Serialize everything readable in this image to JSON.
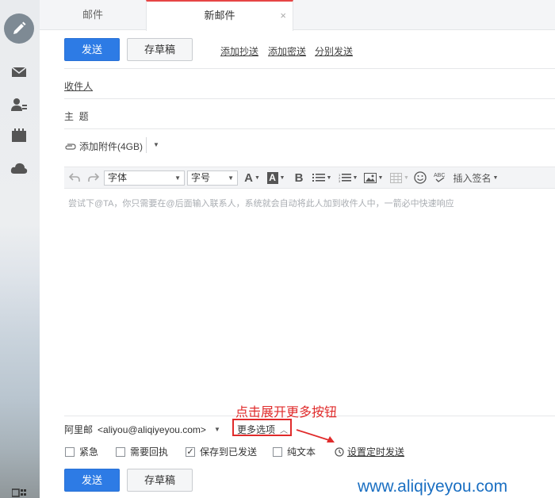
{
  "tabs": {
    "mail": "邮件",
    "new_mail": "新邮件",
    "close": "×"
  },
  "toolbar_top": {
    "send": "发送",
    "draft": "存草稿",
    "add_cc": "添加抄送",
    "add_bcc": "添加密送",
    "separate_send": "分别发送"
  },
  "fields": {
    "recipient": "收件人",
    "subject": "主  题",
    "attach": "添加附件(4GB)"
  },
  "editor": {
    "font": "字体",
    "size": "字号",
    "signature": "插入签名",
    "placeholder": "尝试下@TA，你只需要在@后面输入联系人，系统就会自动将此人加到收件人中，一箭必中快速响应"
  },
  "footer": {
    "sender_name": "阿里邮",
    "sender_email": "<aliyou@aliqiyeyou.com>",
    "more_options": "更多选项",
    "urgent": "紧急",
    "receipt": "需要回执",
    "save_sent": "保存到已发送",
    "plain_text": "纯文本",
    "schedule": "设置定时发送",
    "send": "发送",
    "draft": "存草稿"
  },
  "checkboxes": {
    "urgent": false,
    "receipt": false,
    "save_sent": true,
    "plain_text": false
  },
  "annotation": "点击展开更多按钮",
  "watermark": "www.aliqiyeyou.com",
  "colors": {
    "primary": "#2d7be5",
    "annotation": "#e02b2b",
    "watermark": "#1a6fc2"
  },
  "icons": [
    "pencil-icon",
    "mail-icon",
    "contacts-icon",
    "calendar-icon",
    "cloud-icon",
    "apps-icon"
  ]
}
